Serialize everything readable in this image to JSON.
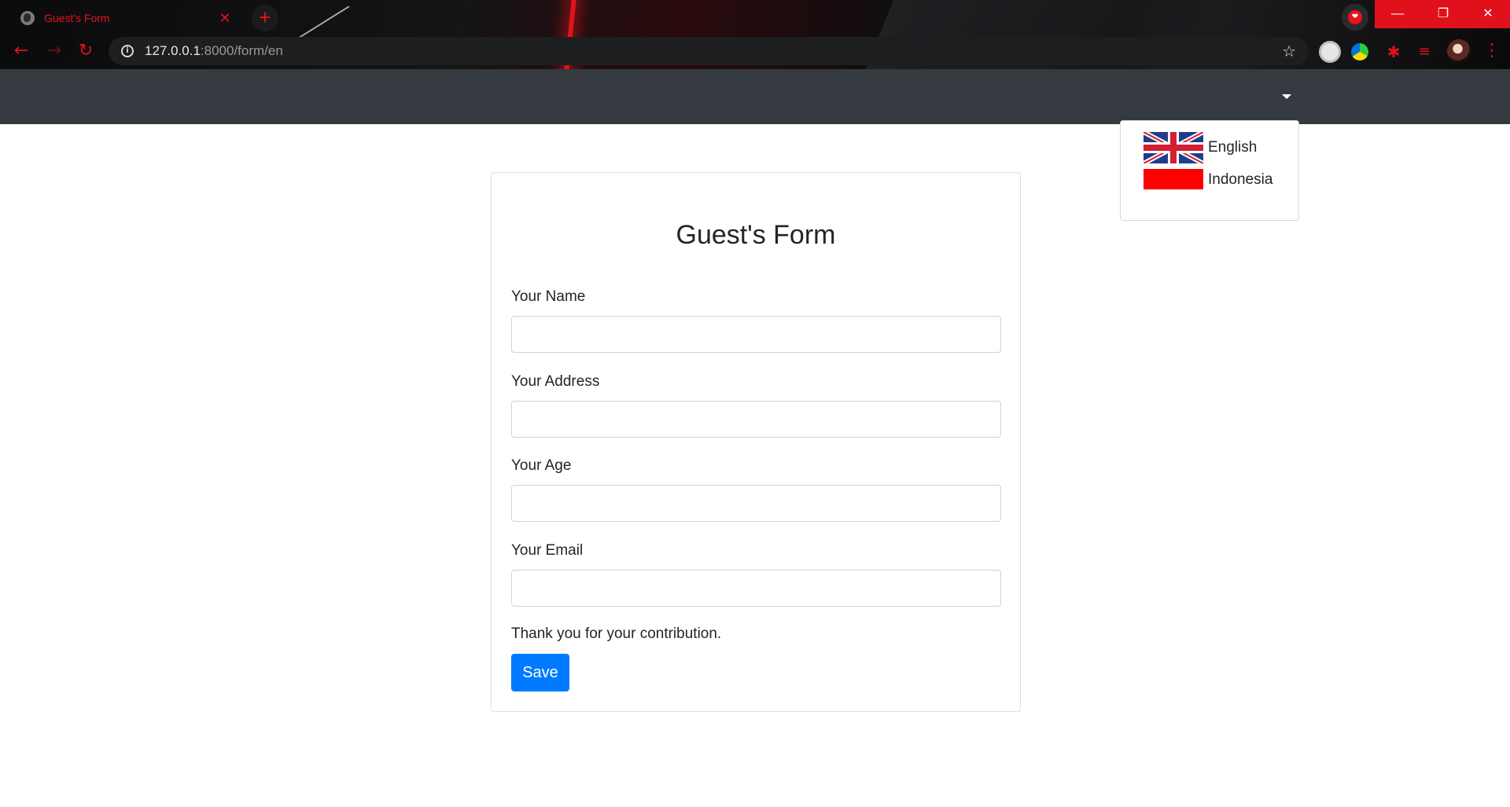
{
  "browser": {
    "tab_title": "Guest's Form",
    "tab_close": "✕",
    "new_tab": "+",
    "url_host": "127.0.0.1",
    "url_path": ":8000/form/en",
    "window_controls": {
      "minimize": "—",
      "maximize": "❐",
      "close": "✕"
    },
    "accent_color": "#e0111b"
  },
  "language_menu": {
    "items": [
      {
        "label": "English",
        "flag_icon": "uk-flag-icon"
      },
      {
        "label": "Indonesia",
        "flag_icon": "indonesia-flag-icon"
      }
    ]
  },
  "form": {
    "title": "Guest's Form",
    "fields": [
      {
        "label": "Your Name",
        "value": ""
      },
      {
        "label": "Your Address",
        "value": ""
      },
      {
        "label": "Your Age",
        "value": ""
      },
      {
        "label": "Your Email",
        "value": ""
      }
    ],
    "thanks_text": "Thank you for your contribution.",
    "save_label": "Save",
    "save_color": "#007bff"
  },
  "navbar_color": "#343a40"
}
